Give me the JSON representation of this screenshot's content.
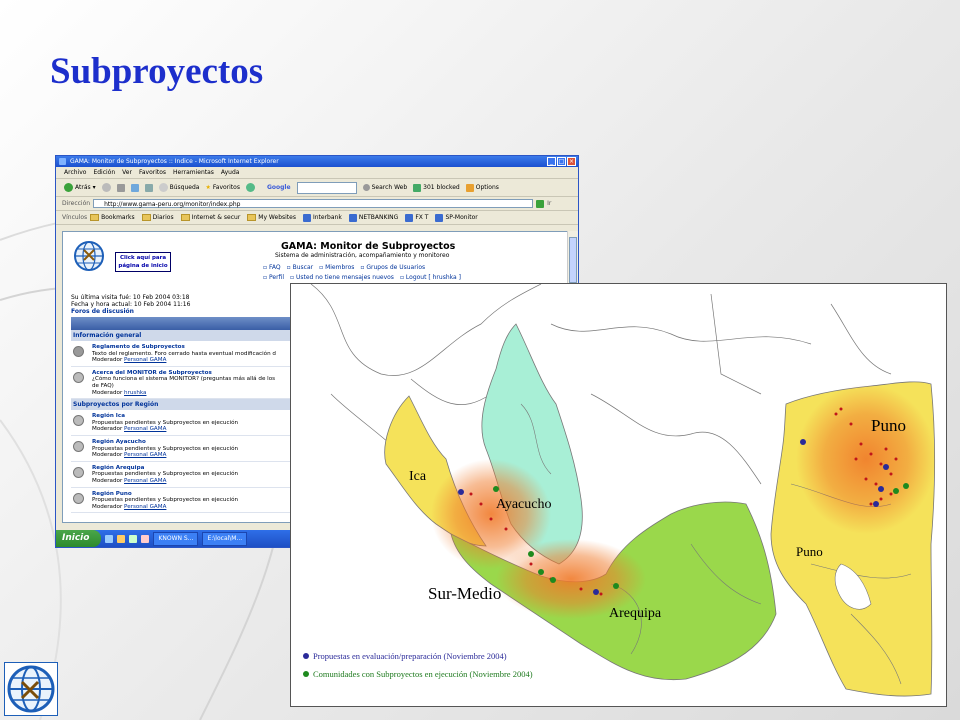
{
  "slide": {
    "title": "Subproyectos"
  },
  "browser": {
    "window_title": "GAMA: Monitor de Subproyectos :: Indice - Microsoft Internet Explorer",
    "menu": [
      "Archivo",
      "Edición",
      "Ver",
      "Favoritos",
      "Herramientas",
      "Ayuda"
    ],
    "toolbar": {
      "back": "Atrás",
      "search": "Búsqueda",
      "favorites": "Favoritos",
      "google": "Google",
      "search_web": "Search Web",
      "blocked": "301 blocked",
      "options": "Options"
    },
    "address": {
      "label": "Dirección",
      "url": "http://www.gama-peru.org/monitor/index.php",
      "go": "Ir"
    },
    "links": {
      "label": "Vínculos",
      "items": [
        "Bookmarks",
        "Diarios",
        "Internet & secur",
        "My Websites",
        "Interbank",
        "NETBANKING",
        "FX T",
        "SP-Monitor"
      ]
    },
    "page": {
      "click_box": "Click aquí para página de inicio",
      "site_title": "GAMA: Monitor de Subproyectos",
      "site_subtitle": "Sistema de administración, acompañamiento y monitoreo",
      "nav": [
        "FAQ",
        "Buscar",
        "Miembros",
        "Grupos de Usuarios"
      ],
      "nav2": [
        "Perfil",
        "Usted no tiene mensajes nuevos",
        "Logout [ hrushka ]"
      ],
      "last_visit": "Su última visita fué: 10 Feb 2004 03:18",
      "current_date": "Fecha y hora actual: 10 Feb 2004 11:16",
      "forums_link": "Foros de discusión",
      "forum_header": "Foro",
      "categories": [
        {
          "name": "Información general",
          "forums": [
            {
              "title": "Reglamento de Subproyectos",
              "desc": "Texto del reglamento. Foro cerrado hasta eventual modificación d",
              "mod_label": "Moderador",
              "mod": "Personal GAMA",
              "locked": true
            },
            {
              "title": "Acerca del MONITOR de Subproyectos",
              "desc": "¿Cómo funciona el sistema MONITOR? (preguntas más allá de los",
              "desc2": "de FAQ)",
              "mod_label": "Moderador",
              "mod": "hrushka",
              "locked": false
            }
          ]
        },
        {
          "name": "Subproyectos por Región",
          "forums": [
            {
              "title": "Región Ica",
              "desc": "Propuestas pendientes y Subproyectos en ejecución",
              "mod_label": "Moderador",
              "mod": "Personal GAMA",
              "locked": false
            },
            {
              "title": "Región Ayacucho",
              "desc": "Propuestas pendientes y Subproyectos en ejecución",
              "mod_label": "Moderador",
              "mod": "Personal GAMA",
              "locked": false
            },
            {
              "title": "Región Arequipa",
              "desc": "Propuestas pendientes y Subproyectos en ejecución",
              "mod_label": "Moderador",
              "mod": "Personal GAMA",
              "locked": false
            },
            {
              "title": "Región Puno",
              "desc": "Propuestas pendientes y Subproyectos en ejecución",
              "mod_label": "Moderador",
              "mod": "Personal GAMA",
              "locked": false
            }
          ]
        }
      ]
    },
    "taskbar": {
      "start": "Inicio",
      "tasks": [
        "KNOWN S...",
        "E:\\local\\M..."
      ]
    }
  },
  "map": {
    "regions": [
      "Ica",
      "Ayacucho",
      "Sur-Medio",
      "Arequipa",
      "Puno",
      "Puno"
    ],
    "legend": [
      {
        "label": "Propuestas en evaluación/preparación (Noviembre 2004)",
        "color": "#2a2a99"
      },
      {
        "label": "Comunidades con Subproyectos en ejecución (Noviembre 2004)",
        "color": "#1e8a1e"
      }
    ],
    "colors": {
      "ica": "#f5e25a",
      "ayacucho": "#a8efd6",
      "arequipa": "#9ad84b",
      "puno": "#f5e25a",
      "hotspot": "#f07a2a"
    }
  }
}
